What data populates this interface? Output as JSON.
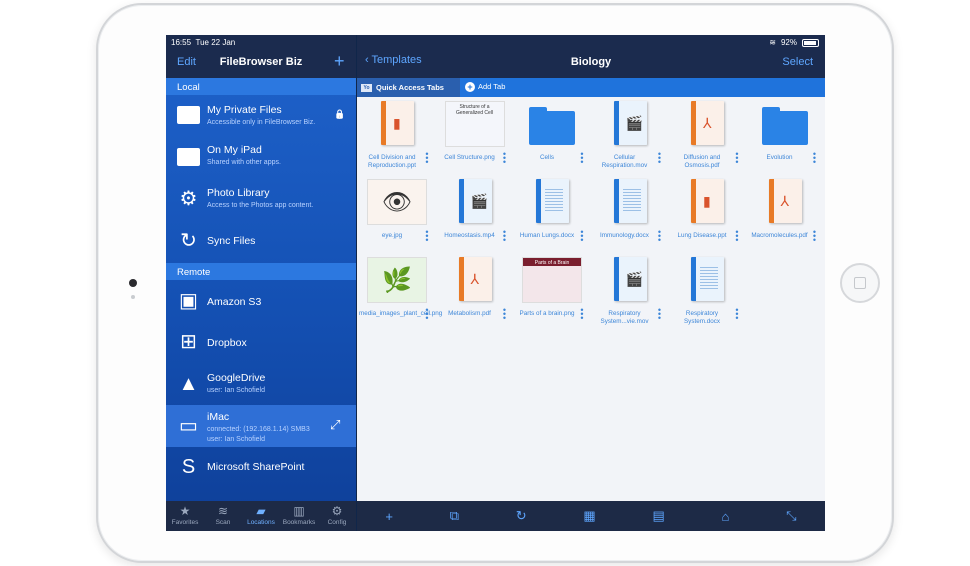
{
  "status": {
    "time": "16:55",
    "date": "Tue 22 Jan",
    "battery": "92%"
  },
  "left_nav": {
    "edit": "Edit",
    "title": "FileBrowser Biz",
    "add": "+"
  },
  "sections": {
    "local": "Local",
    "remote": "Remote"
  },
  "local_items": [
    {
      "label": "My Private Files",
      "sub": "Accessible only in FileBrowser Biz.",
      "icon": "folder-icon"
    },
    {
      "label": "On My iPad",
      "sub": "Shared with other apps.",
      "icon": "folder-icon"
    },
    {
      "label": "Photo Library",
      "sub": "Access to the Photos app content.",
      "icon": "gear-icon"
    },
    {
      "label": "Sync Files",
      "sub": "",
      "icon": "sync-icon"
    }
  ],
  "remote_items": [
    {
      "label": "Amazon S3",
      "sub": "",
      "icon": "amazon-s3-icon"
    },
    {
      "label": "Dropbox",
      "sub": "",
      "icon": "windows-icon"
    },
    {
      "label": "GoogleDrive",
      "sub": "user: Ian Schofield",
      "icon": "google-drive-icon"
    },
    {
      "label": "iMac",
      "sub": "connected: (192.168.1.14) SMB3",
      "sub2": "user: Ian Schofield",
      "icon": "monitor-icon"
    },
    {
      "label": "Microsoft SharePoint",
      "sub": "",
      "icon": "sharepoint-icon"
    }
  ],
  "tabs": [
    {
      "label": "Favorites",
      "icon": "★"
    },
    {
      "label": "Scan",
      "icon": "≋"
    },
    {
      "label": "Locations",
      "icon": "▰"
    },
    {
      "label": "Bookmarks",
      "icon": "▥"
    },
    {
      "label": "Config",
      "icon": "⚙"
    }
  ],
  "right_nav": {
    "back": "Templates",
    "title": "Biology",
    "select": "Select"
  },
  "quick": {
    "tab_label": "Quick Access Tabs",
    "tab_icon_text": "Yo",
    "add_tab": "Add Tab"
  },
  "files": [
    {
      "name": "Cell Division and Reproduction.ppt",
      "kind": "doc-orange",
      "glyph": "▮"
    },
    {
      "name": "Cell Structure.png",
      "kind": "image",
      "glyph": "Structure of a Generalized Cell"
    },
    {
      "name": "Cells",
      "kind": "folder",
      "glyph": ""
    },
    {
      "name": "Cellular Respiration.mov",
      "kind": "doc-blue",
      "glyph": "🎬"
    },
    {
      "name": "Diffusion and Osmosis.pdf",
      "kind": "doc-orange",
      "glyph": "⅄"
    },
    {
      "name": "Evolution",
      "kind": "folder",
      "glyph": ""
    },
    {
      "name": "eye.jpg",
      "kind": "image",
      "glyph": "👁"
    },
    {
      "name": "Homeostasis.mp4",
      "kind": "doc-blue",
      "glyph": "🎬"
    },
    {
      "name": "Human Lungs.docx",
      "kind": "doc-blue-lines",
      "glyph": ""
    },
    {
      "name": "Immunology.docx",
      "kind": "doc-blue-lines",
      "glyph": ""
    },
    {
      "name": "Lung Disease.ppt",
      "kind": "doc-orange",
      "glyph": "▮"
    },
    {
      "name": "Macromolecules.pdf",
      "kind": "doc-orange",
      "glyph": "⅄"
    },
    {
      "name": "media_images_plant_cell.png",
      "kind": "image",
      "glyph": "🌿"
    },
    {
      "name": "Metabolism.pdf",
      "kind": "doc-orange",
      "glyph": "⅄"
    },
    {
      "name": "Parts of a brain.png",
      "kind": "image",
      "glyph": "Parts of a Brain"
    },
    {
      "name": "Respiratory System...vie.mov",
      "kind": "doc-blue",
      "glyph": "🎬"
    },
    {
      "name": "Respiratory System.docx",
      "kind": "doc-blue-lines",
      "glyph": ""
    }
  ],
  "toolbar": [
    {
      "icon": "+",
      "name": "add-button"
    },
    {
      "icon": "⧉",
      "name": "open-in-button"
    },
    {
      "icon": "↻",
      "name": "refresh-button"
    },
    {
      "icon": "▦",
      "name": "grid-view-button"
    },
    {
      "icon": "▤",
      "name": "sort-button"
    },
    {
      "icon": "⌂",
      "name": "home-button"
    },
    {
      "icon": "⤡",
      "name": "expand-button"
    }
  ],
  "colors": {
    "accent": "#5ea6ff",
    "panel_blue": "#1f63cc",
    "nav_dark": "#1b2b4e",
    "file_text": "#3d86d8"
  }
}
